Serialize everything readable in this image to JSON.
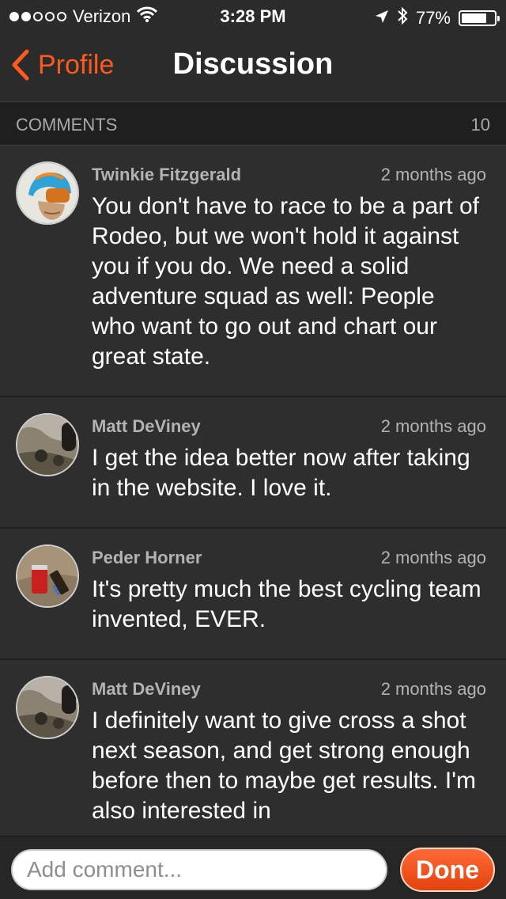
{
  "status_bar": {
    "carrier": "Verizon",
    "signal_filled": 2,
    "signal_total": 5,
    "time": "3:28 PM",
    "battery": "77%",
    "battery_level": 0.77
  },
  "nav": {
    "back_label": "Profile",
    "title": "Discussion"
  },
  "section": {
    "label": "COMMENTS",
    "count": "10"
  },
  "comments": [
    {
      "author": "Twinkie Fitzgerald",
      "time": "2 months ago",
      "text": "You don't have to race to be a part of Rodeo, but we won't hold it against you if you do. We need a solid adventure squad as well: People who want to go out and chart our great state."
    },
    {
      "author": "Matt DeViney",
      "time": "2 months ago",
      "text": "I get the idea better now after taking in the website. I love it."
    },
    {
      "author": "Peder Horner",
      "time": "2 months ago",
      "text": "It's pretty much the best cycling team invented, EVER."
    },
    {
      "author": "Matt DeViney",
      "time": "2 months ago",
      "text": "I definitely want to give cross a shot next season, and get strong enough before then to maybe get results. I'm also interested in"
    }
  ],
  "composer": {
    "placeholder": "Add comment...",
    "done_label": "Done"
  },
  "colors": {
    "accent": "#fc5a1e",
    "background": "#2e2e2e",
    "section_bg": "#1f1f1f"
  }
}
